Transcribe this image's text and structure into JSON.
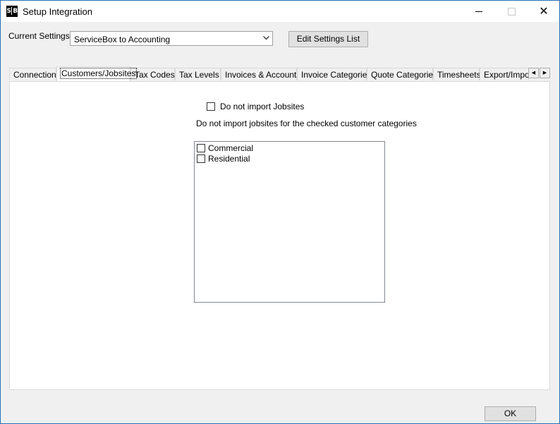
{
  "window": {
    "title": "Setup Integration",
    "icon_text": "SB",
    "controls": [
      "minimize",
      "maximize",
      "close"
    ]
  },
  "settings": {
    "label": "Current Settings",
    "selected": "ServiceBox to Accounting",
    "edit_button": "Edit Settings List"
  },
  "tabs": [
    {
      "label": "Connection"
    },
    {
      "label": "Customers/Jobsites",
      "active": true
    },
    {
      "label": "Tax Codes"
    },
    {
      "label": "Tax Levels"
    },
    {
      "label": "Invoices & Accounts"
    },
    {
      "label": "Invoice Categories"
    },
    {
      "label": "Quote Categories"
    },
    {
      "label": "Timesheets"
    },
    {
      "label": "Export/Impor"
    }
  ],
  "tab_scroll": {
    "left": "◀",
    "right": "▶"
  },
  "panel": {
    "do_not_import_label": "Do not import Jobsites",
    "do_not_import_checked": false,
    "description": "Do not import jobsites for the checked customer categories",
    "categories": [
      {
        "label": "Commercial",
        "checked": false
      },
      {
        "label": "Residential",
        "checked": false
      }
    ]
  },
  "footer": {
    "ok_button": "OK"
  }
}
